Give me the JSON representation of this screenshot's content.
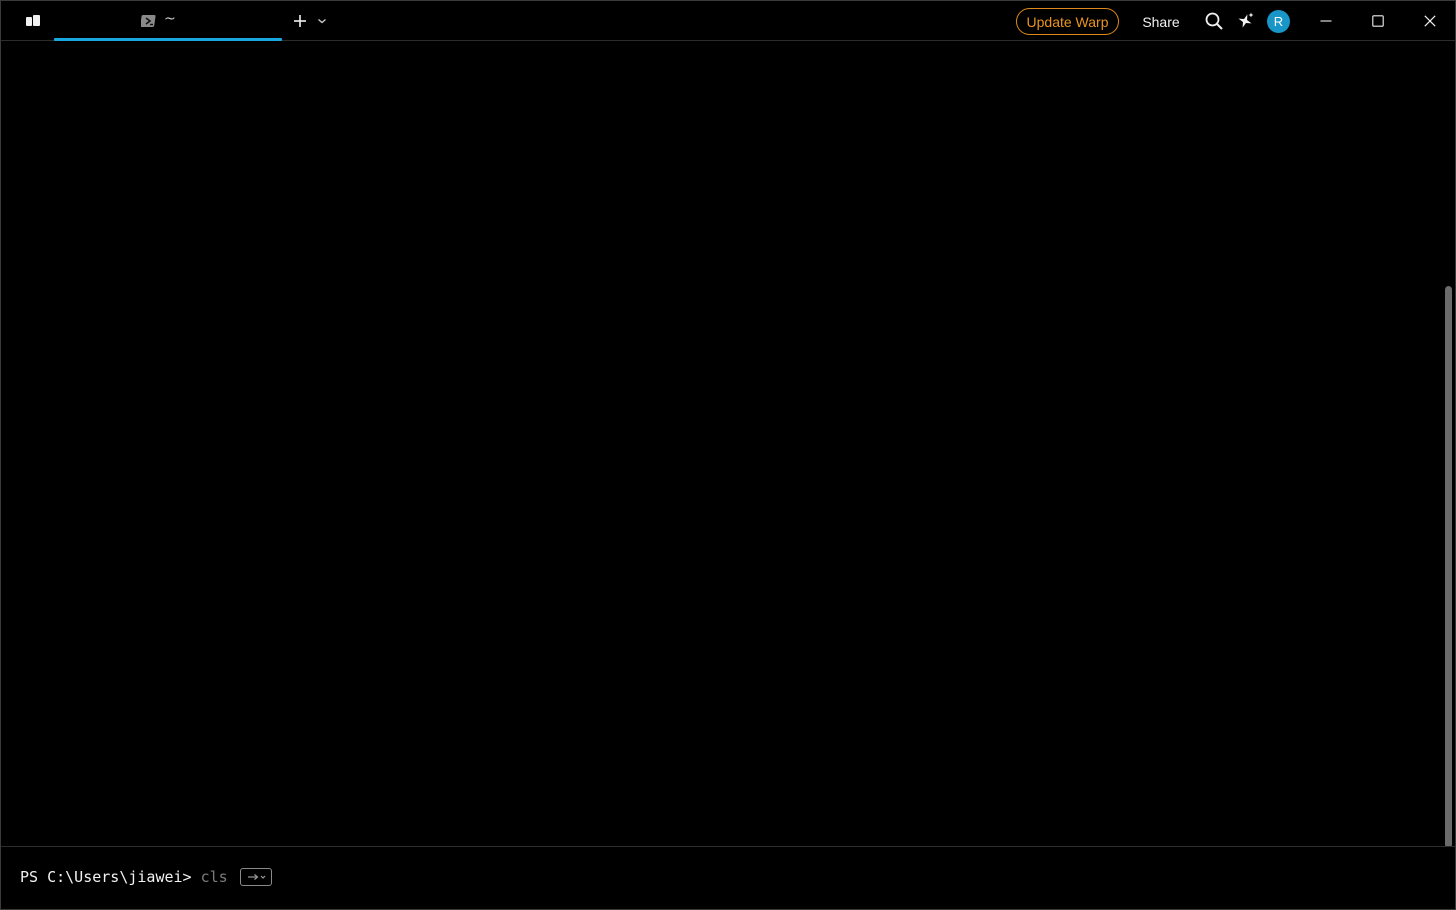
{
  "tab": {
    "title": "~",
    "icon": "powershell-icon"
  },
  "titlebar": {
    "update_label": "Update Warp",
    "share_label": "Share",
    "avatar_initial": "R"
  },
  "colors": {
    "accent": "#19a7e0",
    "update": "#e8951f",
    "avatar_bg": "#1996c8",
    "background": "#000000"
  },
  "input": {
    "prompt": "PS C:\\Users\\jiawei>",
    "suggestion": "cls"
  }
}
